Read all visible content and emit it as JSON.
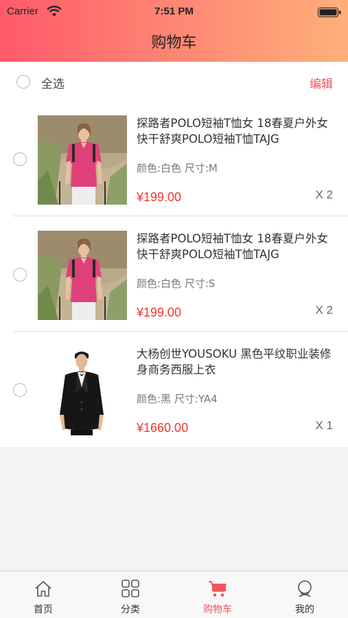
{
  "status_bar": {
    "carrier": "Carrier",
    "time": "7:51 PM"
  },
  "nav": {
    "title": "购物车"
  },
  "select_all": {
    "label": "全选",
    "edit_label": "编辑"
  },
  "items": [
    {
      "name": "探路者POLO短袖T恤女 18春夏户外女快干舒爽POLO短袖T恤TAJG",
      "spec": "颜色:白色 尺寸:M",
      "price": "¥199.00",
      "quantity": "X 2",
      "image": "pink-polo-woman"
    },
    {
      "name": "探路者POLO短袖T恤女 18春夏户外女快干舒爽POLO短袖T恤TAJG",
      "spec": "颜色:白色 尺寸:S",
      "price": "¥199.00",
      "quantity": "X 2",
      "image": "pink-polo-woman"
    },
    {
      "name": "大杨创世YOUSOKU 黑色平纹职业装修身商务西服上衣",
      "spec": "颜色:黑 尺寸:YA4",
      "price": "¥1660.00",
      "quantity": "X 1",
      "image": "black-suit-man"
    }
  ],
  "tabs": [
    {
      "label": "首页",
      "icon": "home-icon"
    },
    {
      "label": "分类",
      "icon": "category-grid-icon"
    },
    {
      "label": "购物车",
      "icon": "cart-icon",
      "active": true
    },
    {
      "label": "我的",
      "icon": "user-icon"
    }
  ],
  "colors": {
    "accent": "#f0545c",
    "price": "#f0362e",
    "header_gradient_start": "#ff5a6a",
    "header_gradient_end": "#ffb07a"
  }
}
